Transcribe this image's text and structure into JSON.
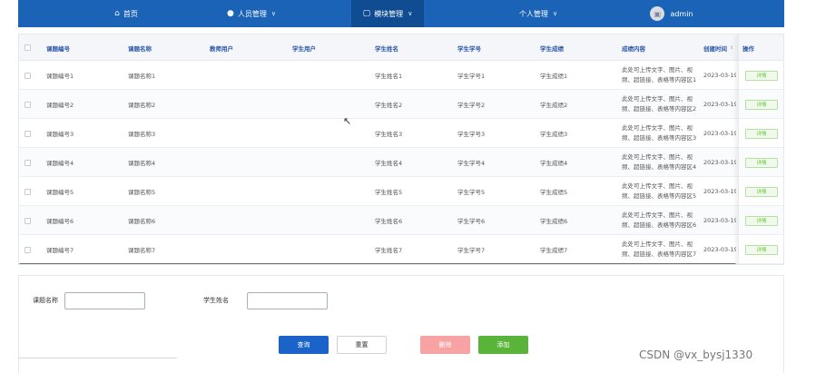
{
  "nav": {
    "home": "首页",
    "people": "人员管理",
    "modules": "模块管理",
    "personal": "个人管理",
    "user": "admin"
  },
  "table": {
    "headers": [
      "课题编号",
      "课题名称",
      "教师用户",
      "学生用户",
      "学生姓名",
      "学生学号",
      "学生成绩",
      "成绩内容",
      "创建时间",
      "操作"
    ],
    "rows": [
      {
        "code": "课题编号1",
        "name": "课题名称1",
        "teacher": "",
        "student": "",
        "sname": "学生姓名1",
        "sno": "学生学号1",
        "score": "学生成绩1",
        "content": "此处可上传文字、图片、视频、超链接、表格等内容区1",
        "created": "2023-03-19 1",
        "action": "详情"
      },
      {
        "code": "课题编号2",
        "name": "课题名称2",
        "teacher": "",
        "student": "",
        "sname": "学生姓名2",
        "sno": "学生学号2",
        "score": "学生成绩2",
        "content": "此处可上传文字、图片、视频、超链接、表格等内容区2",
        "created": "2023-03-19 1",
        "action": "详情"
      },
      {
        "code": "课题编号3",
        "name": "课题名称3",
        "teacher": "",
        "student": "",
        "sname": "学生姓名3",
        "sno": "学生学号3",
        "score": "学生成绩3",
        "content": "此处可上传文字、图片、视频、超链接、表格等内容区3",
        "created": "2023-03-19 1",
        "action": "详情"
      },
      {
        "code": "课题编号4",
        "name": "课题名称4",
        "teacher": "",
        "student": "",
        "sname": "学生姓名4",
        "sno": "学生学号4",
        "score": "学生成绩4",
        "content": "此处可上传文字、图片、视频、超链接、表格等内容区4",
        "created": "2023-03-19 1",
        "action": "详情"
      },
      {
        "code": "课题编号5",
        "name": "课题名称5",
        "teacher": "",
        "student": "",
        "sname": "学生姓名5",
        "sno": "学生学号5",
        "score": "学生成绩5",
        "content": "此处可上传文字、图片、视频、超链接、表格等内容区5",
        "created": "2023-03-19 1",
        "action": "详情"
      },
      {
        "code": "课题编号6",
        "name": "课题名称6",
        "teacher": "",
        "student": "",
        "sname": "学生姓名6",
        "sno": "学生学号6",
        "score": "学生成绩6",
        "content": "此处可上传文字、图片、视频、超链接、表格等内容区6",
        "created": "2023-03-19 1",
        "action": "详情"
      },
      {
        "code": "课题编号7",
        "name": "课题名称7",
        "teacher": "",
        "student": "",
        "sname": "学生姓名7",
        "sno": "学生学号7",
        "score": "学生成绩7",
        "content": "此处可上传文字、图片、视频、超链接、表格等内容区7",
        "created": "2023-03-19 1",
        "action": "详情"
      }
    ]
  },
  "search": {
    "topic_label": "课题名称",
    "topic_value": "",
    "student_label": "学生姓名",
    "student_value": "",
    "query": "查询",
    "reset": "重置",
    "delete": "删除",
    "add": "添加"
  },
  "watermark": "CSDN @vx_bysj1330",
  "icons": {
    "home": "home-icon",
    "people": "user-icon",
    "modules": "copy-icon",
    "chevron": "chevron-down-icon",
    "avatar": "avatar-icon"
  },
  "colors": {
    "nav": "#1b63b6",
    "nav_active": "#0f4c92",
    "header_text": "#2a57a8",
    "query": "#1b63c9",
    "delete": "#f7a3a3",
    "add": "#5ab43a",
    "detail": "#67c23a"
  }
}
